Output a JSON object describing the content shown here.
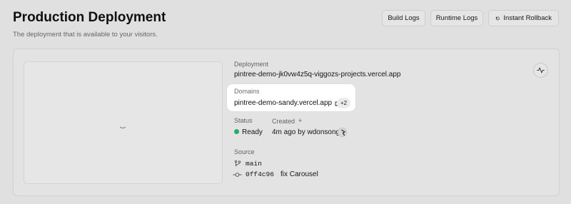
{
  "header": {
    "title": "Production Deployment",
    "subtitle": "The deployment that is available to your visitors."
  },
  "toolbar": {
    "build_logs": "Build Logs",
    "runtime_logs": "Runtime Logs",
    "instant_rollback": "Instant Rollback"
  },
  "deployment": {
    "label": "Deployment",
    "url": "pintree-demo-jk0vw4z5q-viggozs-projects.vercel.app"
  },
  "domains": {
    "label": "Domains",
    "primary": "pintree-demo-sandy.vercel.app",
    "more_count": "+2"
  },
  "status": {
    "label": "Status",
    "value": "Ready",
    "color": "#2fb67c"
  },
  "created": {
    "label": "Created",
    "value": "4m ago by wdonsong"
  },
  "source": {
    "label": "Source",
    "branch": "main",
    "commit_hash": "0ff4c96",
    "commit_message": "fix Carousel"
  },
  "icons": {
    "rollback": "rollback-icon",
    "activity": "activity-icon",
    "external_link": "external-link-icon",
    "info": "info-icon",
    "branch": "git-branch-icon",
    "commit": "git-commit-icon",
    "avatar": "user-avatar"
  }
}
